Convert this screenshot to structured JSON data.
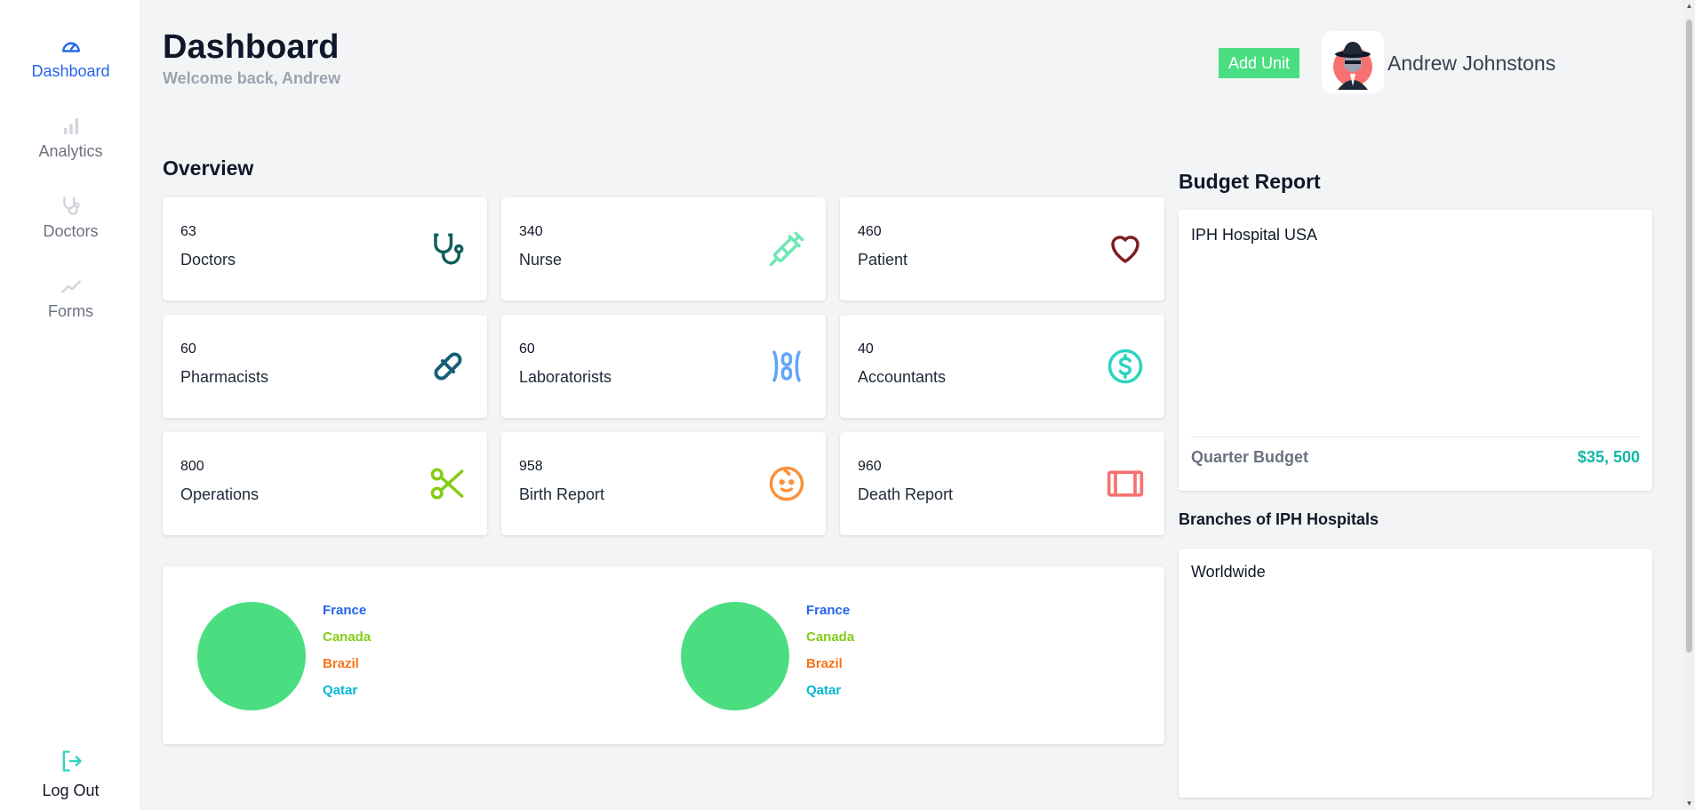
{
  "sidebar": {
    "items": [
      {
        "label": "Dashboard",
        "icon": "gauge-icon",
        "active": true
      },
      {
        "label": "Analytics",
        "icon": "bar-chart-icon",
        "active": false
      },
      {
        "label": "Doctors",
        "icon": "stethoscope-icon",
        "active": false
      },
      {
        "label": "Forms",
        "icon": "trend-line-icon",
        "active": false
      }
    ],
    "logout_label": "Log Out"
  },
  "header": {
    "title": "Dashboard",
    "subtitle": "Welcome back, Andrew",
    "add_unit_label": "Add Unit",
    "user_name": "Andrew Johnstons"
  },
  "overview": {
    "title": "Overview",
    "cards": [
      {
        "value": "63",
        "label": "Doctors",
        "icon": "stethoscope-icon",
        "color": "#115e59"
      },
      {
        "value": "340",
        "label": "Nurse",
        "icon": "syringe-icon",
        "color": "#6ee7b7"
      },
      {
        "value": "460",
        "label": "Patient",
        "icon": "heart-icon",
        "color": "#7f1d1d"
      },
      {
        "value": "60",
        "label": "Pharmacists",
        "icon": "pill-icon",
        "color": "#155e75"
      },
      {
        "value": "60",
        "label": "Laboratorists",
        "icon": "lab-icon",
        "color": "#60a5fa"
      },
      {
        "value": "40",
        "label": "Accountants",
        "icon": "dollar-icon",
        "color": "#2dd4bf"
      },
      {
        "value": "800",
        "label": "Operations",
        "icon": "scissors-icon",
        "color": "#84cc16"
      },
      {
        "value": "958",
        "label": "Birth Report",
        "icon": "baby-icon",
        "color": "#fb923c"
      },
      {
        "value": "960",
        "label": "Death Report",
        "icon": "coffin-icon",
        "color": "#f87171"
      }
    ]
  },
  "pies": [
    {
      "legend": [
        "France",
        "Canada",
        "Brazil",
        "Qatar"
      ],
      "color": "#4ade80"
    },
    {
      "legend": [
        "France",
        "Canada",
        "Brazil",
        "Qatar"
      ],
      "color": "#4ade80"
    }
  ],
  "legend_colors": [
    "#2563eb",
    "#84cc16",
    "#f97316",
    "#06b6d4"
  ],
  "budget": {
    "title": "Budget Report",
    "hospital": "IPH Hospital USA",
    "quarter_label": "Quarter Budget",
    "quarter_value": "$35, 500"
  },
  "branches": {
    "title": "Branches of IPH Hospitals",
    "card_title": "Worldwide"
  }
}
